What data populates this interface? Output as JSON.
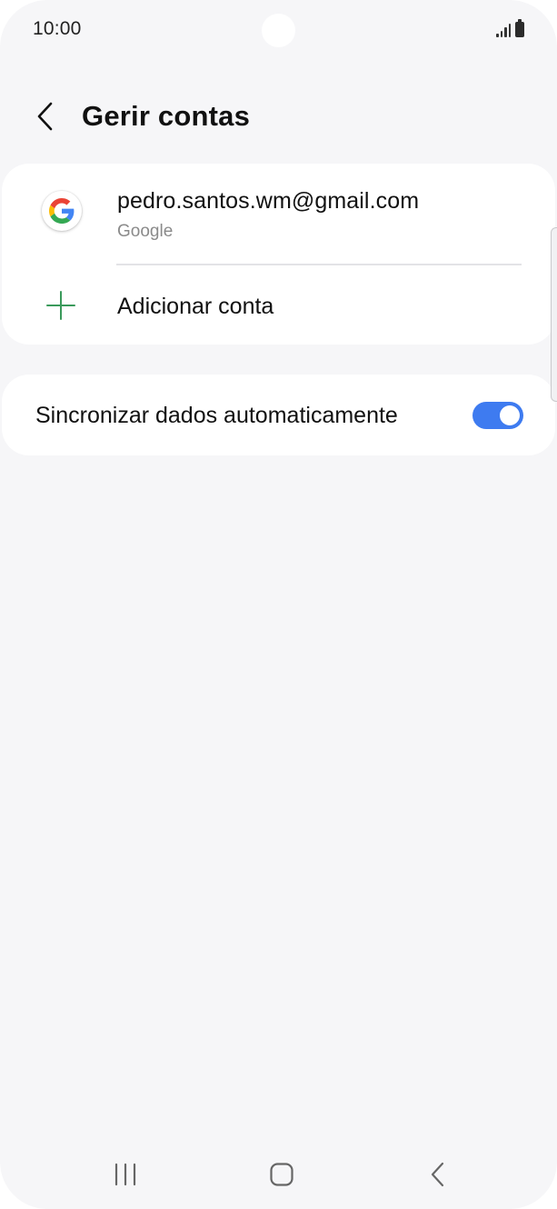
{
  "status_bar": {
    "time": "10:00",
    "icons": [
      "signal-icon",
      "battery-icon"
    ]
  },
  "header": {
    "back_icon": "chevron-left-icon",
    "title": "Gerir contas"
  },
  "accounts": {
    "items": [
      {
        "email": "pedro.santos.wm@gmail.com",
        "type": "Google",
        "icon": "google-icon"
      }
    ],
    "add_account": {
      "label": "Adicionar conta",
      "icon": "plus-icon",
      "color": "#3a9a5b"
    }
  },
  "sync": {
    "label": "Sincronizar dados automaticamente",
    "enabled": true,
    "accent_color": "#3e7bf0"
  },
  "nav_bar": {
    "buttons": [
      "recents-icon",
      "home-icon",
      "back-icon"
    ]
  }
}
